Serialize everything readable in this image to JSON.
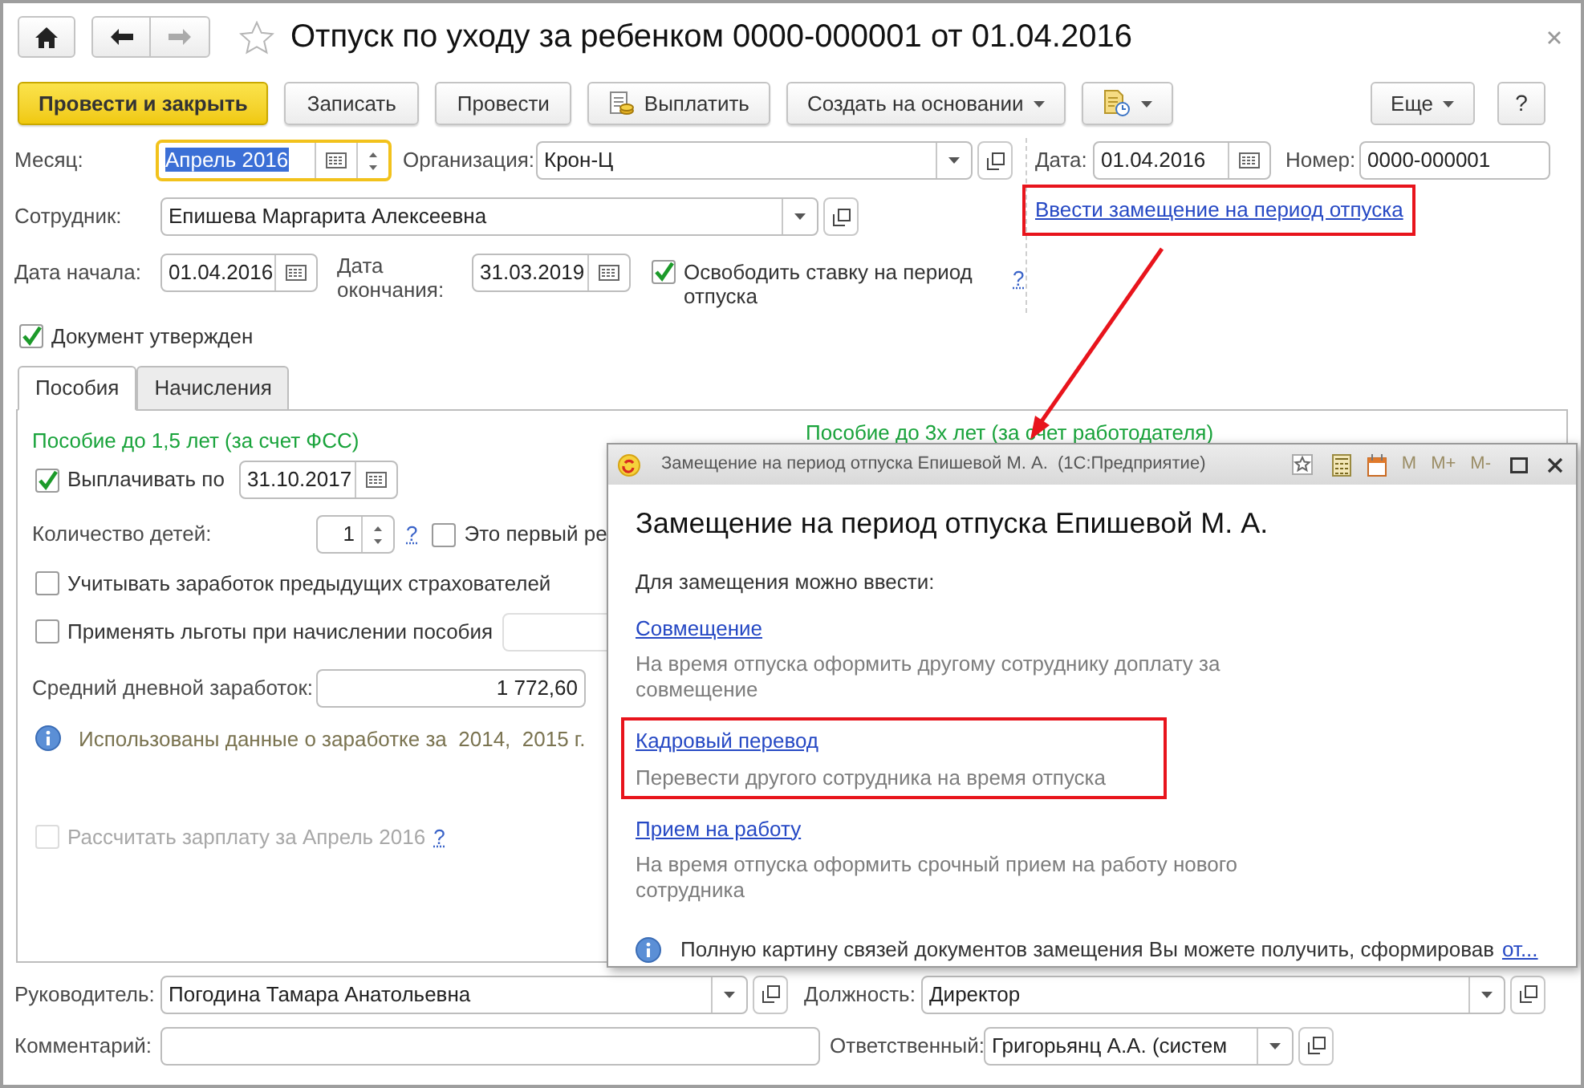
{
  "window": {
    "title": "Отпуск по уходу за ребенком 0000-000001 от 01.04.2016"
  },
  "toolbar": {
    "buttons": [
      {
        "label": "Провести и закрыть",
        "kind": "primary"
      },
      {
        "label": "Записать",
        "kind": "plain"
      },
      {
        "label": "Провести",
        "kind": "plain"
      },
      {
        "label": "Выплатить",
        "kind": "icon_text"
      },
      {
        "label": "Создать на основании",
        "kind": "dropdown"
      },
      {
        "kind": "icon_dropdown"
      }
    ],
    "more": "Еще",
    "help": "?"
  },
  "header": {
    "month": {
      "label": "Месяц:",
      "value": "Апрель 2016",
      "focused": true
    },
    "organization": {
      "label": "Организация:",
      "value": "Крон-Ц"
    },
    "date": {
      "label": "Дата:",
      "value": "01.04.2016"
    },
    "number": {
      "label": "Номер:",
      "value": "0000-000001"
    },
    "employee": {
      "label": "Сотрудник:",
      "value": "Епишева Маргарита Алексеевна"
    },
    "replacement_link": {
      "text": "Ввести замещение на период отпуска",
      "highlighted": true
    },
    "start_date": {
      "label": "Дата начала:",
      "value": "01.04.2016"
    },
    "end_date": {
      "label": "Дата окончания:",
      "value": "31.03.2019"
    },
    "release_rate": {
      "label": "Освободить ставку на период отпуска",
      "checked": true
    },
    "release_help": "?",
    "approved": {
      "label": "Документ утвержден",
      "checked": true
    }
  },
  "tabs": [
    {
      "label": "Пособия",
      "selected": true
    },
    {
      "label": "Начисления",
      "selected": false
    }
  ],
  "benefits": {
    "section_1": "Пособие до 1,5 лет (за счет ФСС)",
    "section_2": "Пособие до 3х лет (за счет работодателя)",
    "pay_until": {
      "label": "Выплачивать по",
      "checked": true,
      "value": "31.10.2017"
    },
    "children": {
      "label": "Количество детей:",
      "value": "1"
    },
    "children_help": "?",
    "first_child": {
      "label": "Это первый ре",
      "checked": false
    },
    "previous_insurers": {
      "label": "Учитывать заработок предыдущих страхователей",
      "checked": false
    },
    "privileges": {
      "label": "Применять льготы при начислении пособия",
      "checked": false
    },
    "average_earnings": {
      "label": "Средний дневной заработок:",
      "value": "1 772,60"
    },
    "info": "Использованы данные о заработке за  2014,  2015 г.",
    "recalculate": {
      "label": "Рассчитать зарплату за Апрель 2016",
      "checked": false,
      "disabled": true
    },
    "recalculate_help": "?"
  },
  "footer": {
    "manager": {
      "label": "Руководитель:",
      "value": "Погодина Тамара Анатольевна"
    },
    "position": {
      "label": "Должность:",
      "value": "Директор"
    },
    "comment": {
      "label": "Комментарий:"
    },
    "responsible": {
      "label": "Ответственный:",
      "value": "Григорьянц А.А. (систем"
    }
  },
  "dialog": {
    "title": "Замещение на период отпуска Епишевой М. А.  (1С:Предприятие)",
    "memory_buttons": [
      {
        "label": "M",
        "disabled": true
      },
      {
        "label": "M+",
        "disabled": true
      },
      {
        "label": "M-",
        "disabled": true
      }
    ],
    "heading": "Замещение на период отпуска Епишевой М. А.",
    "intro": "Для замещения можно ввести:",
    "options": [
      {
        "link": "Совмещение",
        "description": "На время отпуска оформить другому сотруднику доплату за совмещение",
        "highlighted": false
      },
      {
        "link": "Кадровый перевод",
        "description": "Перевести другого сотрудника на время отпуска",
        "highlighted": true
      },
      {
        "link": "Прием на работу",
        "description": "На время отпуска оформить срочный прием на работу нового сотрудника",
        "highlighted": false
      }
    ],
    "info": "Полную картину связей документов замещения Вы можете получить, сформировав",
    "info_link": "от..."
  }
}
